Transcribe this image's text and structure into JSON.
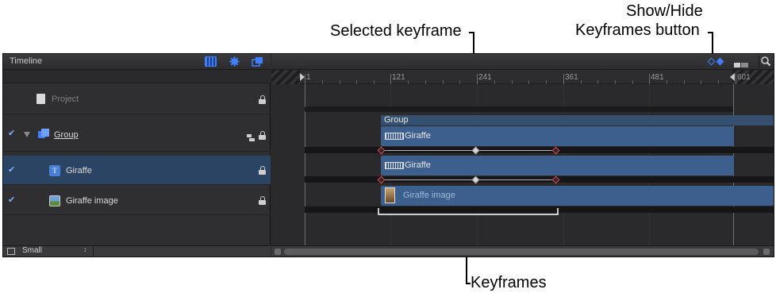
{
  "callouts": {
    "selected_keyframe": "Selected keyframe",
    "show_hide_line1": "Show/Hide",
    "show_hide_line2": "Keyframes button",
    "keyframes": "Keyframes"
  },
  "timeline_panel": {
    "title": "Timeline",
    "icons": [
      "checkerboard-icon",
      "gear-icon",
      "layers-icon"
    ]
  },
  "layers": [
    {
      "name": "Project",
      "checked": false,
      "state": "dimmed"
    },
    {
      "name": "Group",
      "checked": true,
      "expanded": true
    },
    {
      "name": "Giraffe",
      "checked": true,
      "selected": true
    },
    {
      "name": "Giraffe image",
      "checked": true
    }
  ],
  "footer": {
    "size_label": "Small",
    "stepper_glyph": "↕"
  },
  "ruler": {
    "ticks": [
      "1",
      "121",
      "241",
      "361",
      "481",
      "601"
    ]
  },
  "tracks": {
    "group_label": "Group",
    "giraffe_text_label": "Giraffe",
    "giraffe_text_label_2": "Giraffe",
    "giraffe_image_label": "Giraffe image"
  },
  "colors": {
    "accent_blue": "#3f7fff",
    "selected_row": "#2c4463",
    "keyframe_red": "#e04646",
    "bar_blue": "#3c5f8d"
  }
}
